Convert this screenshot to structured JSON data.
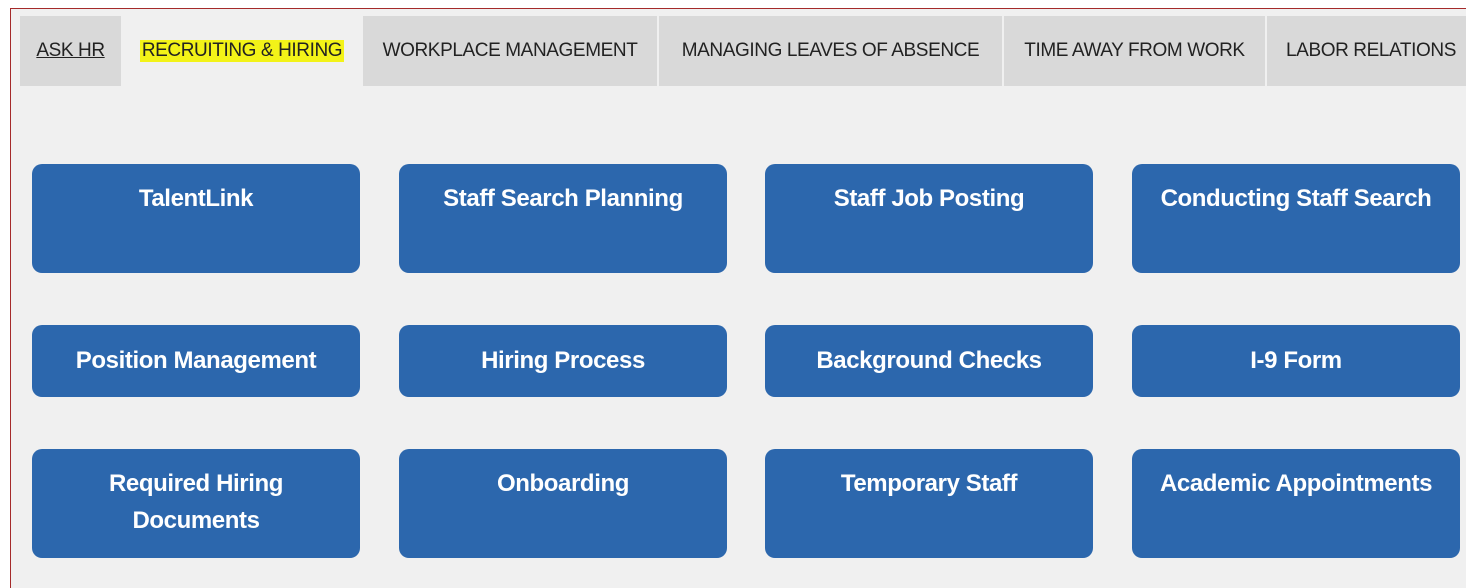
{
  "tabs": [
    {
      "label": "ASK HR",
      "active": false
    },
    {
      "label": "RECRUITING & HIRING",
      "active": true
    },
    {
      "label": "WORKPLACE MANAGEMENT",
      "active": false
    },
    {
      "label": "MANAGING LEAVES OF ABSENCE",
      "active": false
    },
    {
      "label": "TIME AWAY FROM WORK",
      "active": false
    },
    {
      "label": "LABOR RELATIONS",
      "active": false
    }
  ],
  "tiles": [
    [
      "TalentLink",
      "Staff Search Planning",
      "Staff Job Posting",
      "Conducting Staff Search"
    ],
    [
      "Position Management",
      "Hiring Process",
      "Background Checks",
      "I-9 Form"
    ],
    [
      "Required Hiring Documents",
      "Onboarding",
      "Temporary Staff",
      "Academic Appointments"
    ]
  ],
  "colors": {
    "tile_bg": "#2c67ad",
    "tab_bg": "#d9d9d9",
    "panel_bg": "#f0f0f0",
    "highlight": "#f3f318",
    "frame_border": "#a52a2a"
  }
}
